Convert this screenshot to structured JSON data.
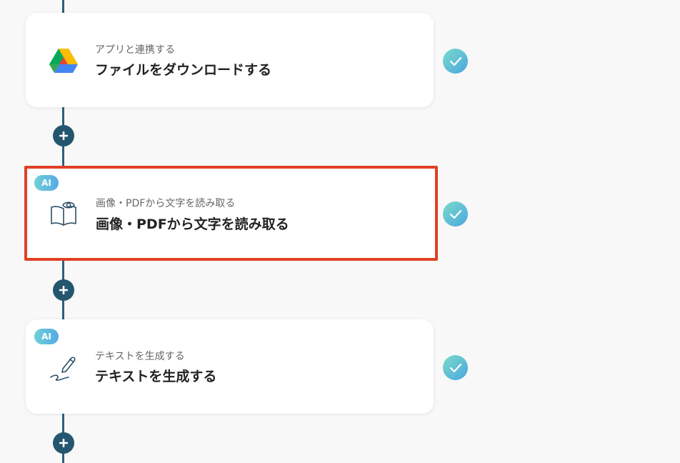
{
  "flow": {
    "steps": [
      {
        "subtitle": "アプリと連携する",
        "title": "ファイルをダウンロードする",
        "icon": "google-drive-icon",
        "ai_badge": "",
        "status": "completed"
      },
      {
        "subtitle": "画像・PDFから文字を読み取る",
        "title": "画像・PDFから文字を読み取る",
        "icon": "book-eye-icon",
        "ai_badge": "AI",
        "status": "completed",
        "selected": true
      },
      {
        "subtitle": "テキストを生成する",
        "title": "テキストを生成する",
        "icon": "pen-icon",
        "ai_badge": "AI",
        "status": "completed"
      }
    ]
  },
  "colors": {
    "line": "#2d5f7a",
    "add_button": "#24566f",
    "selection_border": "#e04026",
    "check_gradient_start": "#7adbc8",
    "check_gradient_end": "#4aa6e0",
    "ai_badge_gradient_start": "#6fd0d8",
    "ai_badge_gradient_end": "#55a9e4"
  }
}
